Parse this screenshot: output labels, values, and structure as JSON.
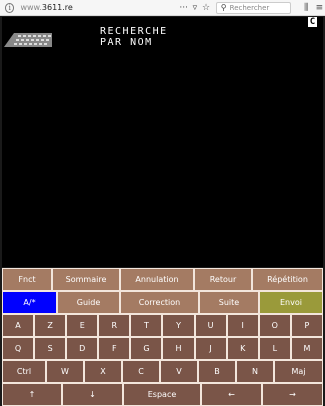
{
  "browser": {
    "url_proto": "www.",
    "url_host": "3611.re",
    "search_placeholder": "Rechercher"
  },
  "screen": {
    "title_line1": "RECHERCHE",
    "title_line2": "PAR NOM",
    "cursor_label": "C"
  },
  "keyboard": {
    "function_row1": [
      "Fnct",
      "Sommaire",
      "Annulation",
      "Retour",
      "Répétition"
    ],
    "function_row2": [
      "A/*",
      "Guide",
      "Correction",
      "Suite",
      "Envoi"
    ],
    "letters_row1": [
      "A",
      "Z",
      "E",
      "R",
      "T",
      "Y",
      "U",
      "I",
      "O",
      "P"
    ],
    "letters_row2": [
      "Q",
      "S",
      "D",
      "F",
      "G",
      "H",
      "J",
      "K",
      "L",
      "M"
    ],
    "letters_row3": [
      "Ctrl",
      "W",
      "X",
      "C",
      "V",
      "B",
      "N",
      "Maj"
    ],
    "bottom_row": [
      "↑",
      "↓",
      "Espace",
      "←",
      "→"
    ]
  },
  "colors": {
    "key_function": "#a47b63",
    "key_letter": "#7a5548",
    "key_active_blue": "#0000ff",
    "key_send_olive": "#9a9a3a"
  }
}
